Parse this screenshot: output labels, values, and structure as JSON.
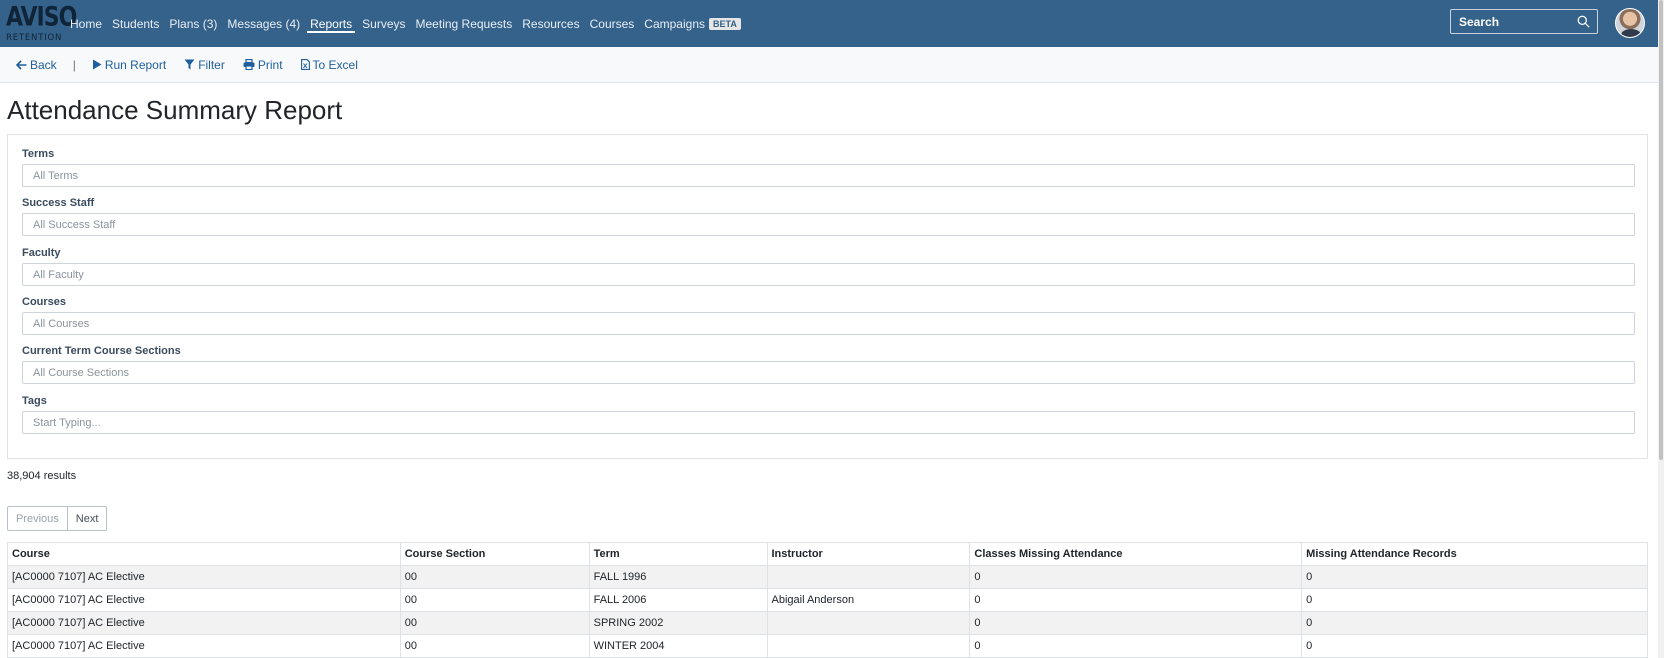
{
  "brand": {
    "line1": "AVISO",
    "line2": "RETENTION"
  },
  "nav": {
    "items": [
      {
        "label": "Home"
      },
      {
        "label": "Students"
      },
      {
        "label": "Plans (3)"
      },
      {
        "label": "Messages (4)"
      },
      {
        "label": "Reports",
        "active": true
      },
      {
        "label": "Surveys"
      },
      {
        "label": "Meeting Requests"
      },
      {
        "label": "Resources"
      },
      {
        "label": "Courses"
      },
      {
        "label": "Campaigns",
        "badge": "BETA"
      }
    ],
    "search_placeholder": "Search"
  },
  "toolbar": {
    "back": "Back",
    "separator": "|",
    "run_report": "Run Report",
    "filter": "Filter",
    "print": "Print",
    "to_excel": "To Excel"
  },
  "page_title": "Attendance Summary Report",
  "filters": [
    {
      "label": "Terms",
      "placeholder": "All Terms"
    },
    {
      "label": "Success Staff",
      "placeholder": "All Success Staff"
    },
    {
      "label": "Faculty",
      "placeholder": "All Faculty"
    },
    {
      "label": "Courses",
      "placeholder": "All Courses"
    },
    {
      "label": "Current Term Course Sections",
      "placeholder": "All Course Sections"
    },
    {
      "label": "Tags",
      "placeholder": "Start Typing..."
    }
  ],
  "results_count": "38,904 results",
  "pager": {
    "previous": "Previous",
    "next": "Next"
  },
  "table": {
    "headers": [
      "Course",
      "Course Section",
      "Term",
      "Instructor",
      "Classes Missing Attendance",
      "Missing Attendance Records"
    ],
    "rows": [
      [
        "[AC0000 7107] AC Elective",
        "00",
        "FALL 1996",
        "",
        "0",
        "0"
      ],
      [
        "[AC0000 7107] AC Elective",
        "00",
        "FALL 2006",
        "Abigail Anderson",
        "0",
        "0"
      ],
      [
        "[AC0000 7107] AC Elective",
        "00",
        "SPRING 2002",
        "",
        "0",
        "0"
      ],
      [
        "[AC0000 7107] AC Elective",
        "00",
        "WINTER 2004",
        "",
        "0",
        "0"
      ]
    ]
  },
  "colors": {
    "nav_bg": "#35628a",
    "link": "#1f5f9d"
  }
}
